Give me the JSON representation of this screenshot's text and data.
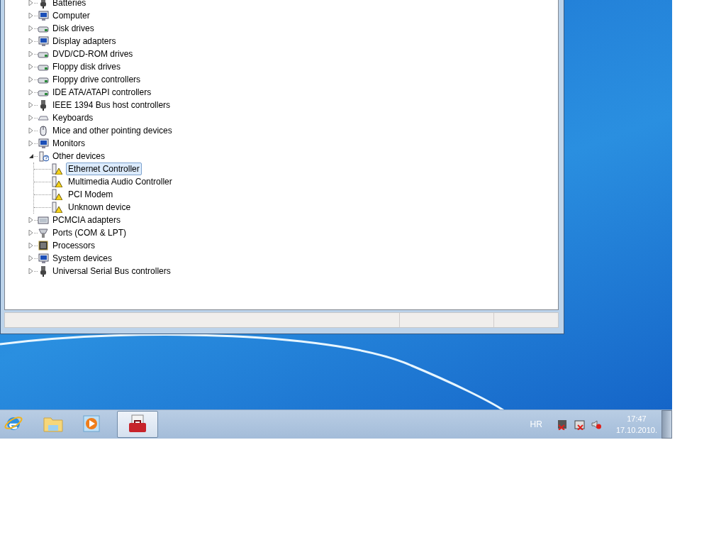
{
  "device_tree": {
    "items": [
      {
        "label": "Batteries",
        "kind": "plug",
        "expanded": false
      },
      {
        "label": "Computer",
        "kind": "monitor",
        "expanded": false
      },
      {
        "label": "Disk drives",
        "kind": "drive",
        "expanded": false
      },
      {
        "label": "Display adapters",
        "kind": "monitor",
        "expanded": false
      },
      {
        "label": "DVD/CD-ROM drives",
        "kind": "drive",
        "expanded": false
      },
      {
        "label": "Floppy disk drives",
        "kind": "drive",
        "expanded": false
      },
      {
        "label": "Floppy drive controllers",
        "kind": "drive",
        "expanded": false
      },
      {
        "label": "IDE ATA/ATAPI controllers",
        "kind": "drive",
        "expanded": false
      },
      {
        "label": "IEEE 1394 Bus host controllers",
        "kind": "plug",
        "expanded": false
      },
      {
        "label": "Keyboards",
        "kind": "keyboard",
        "expanded": false
      },
      {
        "label": "Mice and other pointing devices",
        "kind": "mouse",
        "expanded": false
      },
      {
        "label": "Monitors",
        "kind": "monitor",
        "expanded": false
      },
      {
        "label": "Other devices",
        "kind": "device",
        "expanded": true,
        "children": [
          {
            "label": "Ethernet Controller",
            "selected": true,
            "problem": true
          },
          {
            "label": "Multimedia Audio Controller",
            "selected": false,
            "problem": true
          },
          {
            "label": "PCI Modem",
            "selected": false,
            "problem": true
          },
          {
            "label": "Unknown device",
            "selected": false,
            "problem": true
          }
        ]
      },
      {
        "label": "PCMCIA adapters",
        "kind": "card",
        "expanded": false
      },
      {
        "label": "Ports (COM & LPT)",
        "kind": "port",
        "expanded": false
      },
      {
        "label": "Processors",
        "kind": "chip",
        "expanded": false
      },
      {
        "label": "System devices",
        "kind": "monitor",
        "expanded": false
      },
      {
        "label": "Universal Serial Bus controllers",
        "kind": "plug",
        "expanded": false
      }
    ]
  },
  "taskbar": {
    "buttons": [
      {
        "kind": "browser",
        "selected": false
      },
      {
        "kind": "folder",
        "selected": false
      },
      {
        "kind": "media",
        "selected": false
      },
      {
        "kind": "toolbox",
        "selected": true
      }
    ],
    "language": "HR",
    "tray_icons": [
      {
        "kind": "power"
      },
      {
        "kind": "network"
      },
      {
        "kind": "volume"
      }
    ],
    "time": "17:47",
    "date": "17.10.2010."
  }
}
